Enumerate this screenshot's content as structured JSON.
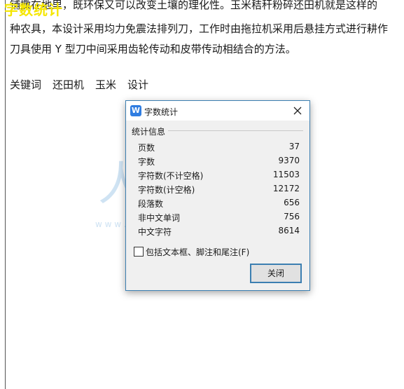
{
  "overlay_label": "字数统计",
  "document": {
    "lines": [
      "铺撒在地里，既环保又可以改变土壤的理化性。玉米秸秆粉碎还田机就是这样的",
      "种农具，本设计采用均力免震法排列刀，工作时由拖拉机采用后悬挂方式进行耕作",
      "刀具使用 Y 型刀中间采用齿轮传动和皮带传动相结合的方法。"
    ],
    "keywords_label": "关键词",
    "keywords": [
      "还田机",
      "玉米",
      "设计"
    ]
  },
  "watermark": {
    "text": "人人文库",
    "url": "w w w . r e n r e n d o c . c o m"
  },
  "dialog": {
    "title": "字数统计",
    "app_icon": "W",
    "group_label": "统计信息",
    "stats": [
      {
        "label": "页数",
        "value": "37"
      },
      {
        "label": "字数",
        "value": "9370"
      },
      {
        "label": "字符数(不计空格)",
        "value": "11503"
      },
      {
        "label": "字符数(计空格)",
        "value": "12172"
      },
      {
        "label": "段落数",
        "value": "656"
      },
      {
        "label": "非中文单词",
        "value": "756"
      },
      {
        "label": "中文字符",
        "value": "8614"
      }
    ],
    "checkbox_label": "包括文本框、脚注和尾注(F)",
    "checkbox_checked": false,
    "close_button": "关闭"
  },
  "colors": {
    "accent": "#3c7fb1",
    "app_icon": "#2f7de1",
    "overlay_label": "#f5e600",
    "watermark": "#cfe3f3"
  }
}
